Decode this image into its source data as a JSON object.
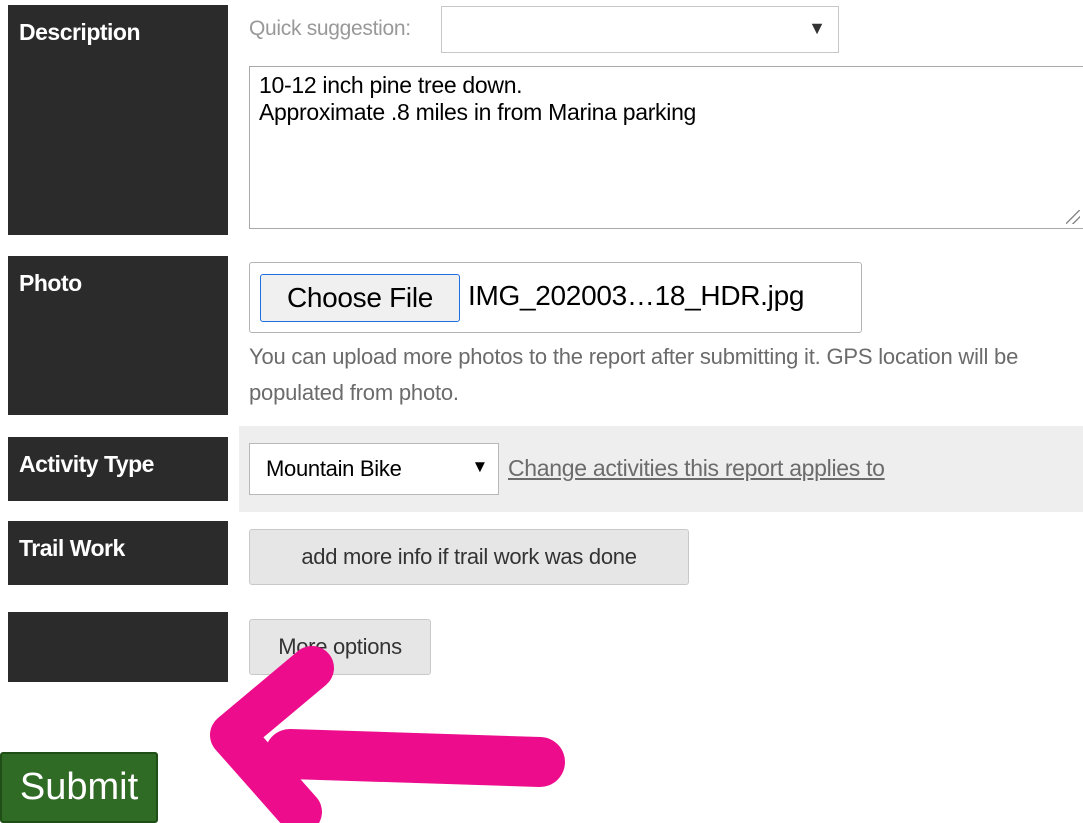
{
  "description": {
    "label": "Description",
    "quick_suggestion_label": "Quick suggestion:",
    "quick_suggestion_value": "",
    "text": "10-12 inch pine tree down.\nApproximate .8 miles in from Marina parking"
  },
  "photo": {
    "label": "Photo",
    "choose_button": "Choose File",
    "file_name": "IMG_202003…18_HDR.jpg",
    "help": "You can upload more photos to the report after submitting it. GPS location will be populated from photo."
  },
  "activity": {
    "label": "Activity Type",
    "selected": "Mountain Bike",
    "change_link": "Change activities this report applies to"
  },
  "trail_work": {
    "label": "Trail Work",
    "button": "add more info if trail work was done"
  },
  "more": {
    "label": "",
    "button": "More options"
  },
  "submit": {
    "label": "Submit"
  },
  "colors": {
    "label_bg": "#2b2b2b",
    "submit_bg": "#2f6b24",
    "annotation_arrow": "#ec0c8c"
  }
}
